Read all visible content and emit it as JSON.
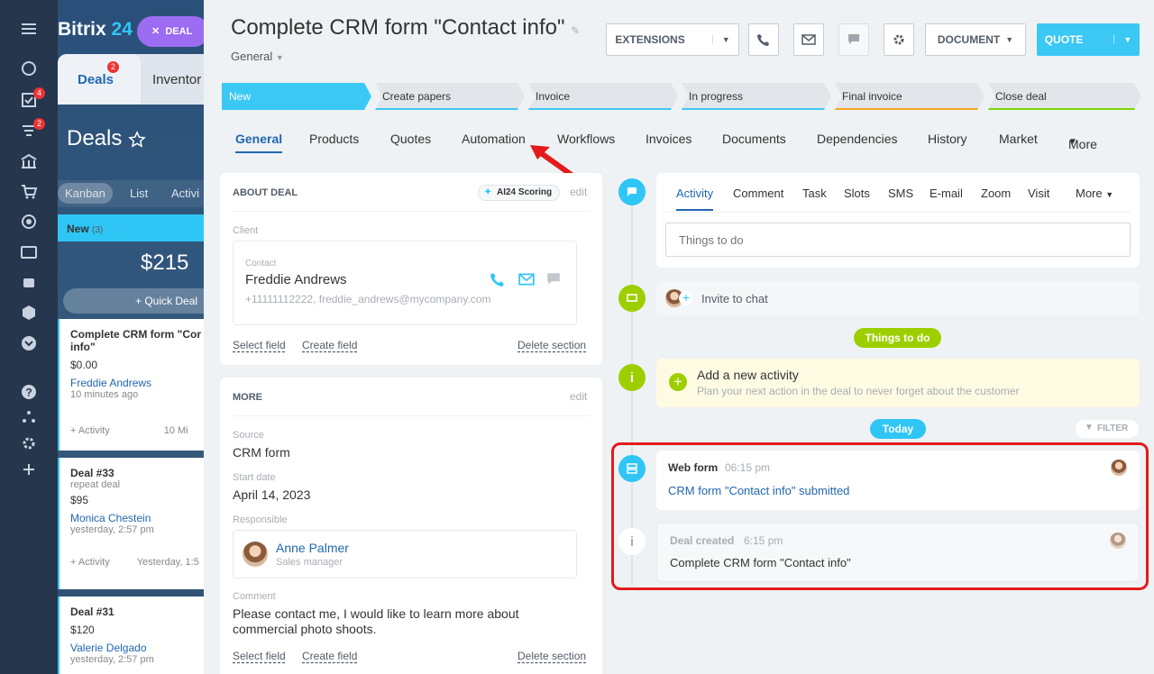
{
  "rail": {
    "badges": {
      "tasks": "4",
      "crm": "2"
    }
  },
  "bg_app": {
    "brand_name": "Bitrix",
    "brand_num": "24",
    "deal_pill": "DEAL",
    "tab_deals": "Deals",
    "tab_deals_badge": "2",
    "tab_inventory": "Inventor",
    "title": "Deals",
    "views": [
      "Kanban",
      "List",
      "Activi"
    ],
    "column": {
      "name": "New",
      "count": "(3)",
      "sum": "$215",
      "quick_deal": "Quick Deal"
    },
    "cards": [
      {
        "title": "Complete CRM form \"Cor info\"",
        "amount": "$0.00",
        "contact": "Freddie Andrews",
        "time": "10 minutes ago",
        "activity": "+ Activity",
        "right": "10 Mi"
      },
      {
        "title": "Deal #33",
        "sub": "repeat deal",
        "amount": "$95",
        "contact": "Monica Chestein",
        "time": "yesterday, 2:57 pm",
        "activity": "+ Activity",
        "right": "Yesterday, 1:5"
      },
      {
        "title": "Deal #31",
        "amount": "$120",
        "contact": "Valerie Delgado",
        "time": "yesterday, 2:57 pm"
      }
    ]
  },
  "header": {
    "title": "Complete CRM form \"Contact info\"",
    "category": "General",
    "buttons": {
      "extensions": "EXTENSIONS",
      "document": "DOCUMENT",
      "quote": "QUOTE"
    }
  },
  "stages": [
    {
      "label": "New",
      "color": "#3bc8f5"
    },
    {
      "label": "Create papers",
      "color": "#3bc8f5"
    },
    {
      "label": "Invoice",
      "color": "#3bc8f5"
    },
    {
      "label": "In progress",
      "color": "#3bc8f5"
    },
    {
      "label": "Final invoice",
      "color": "#f5a623"
    },
    {
      "label": "Close deal",
      "color": "#7bd500"
    }
  ],
  "tabs": [
    "General",
    "Products",
    "Quotes",
    "Automation",
    "Workflows",
    "Invoices",
    "Documents",
    "Dependencies",
    "History",
    "Market",
    "More"
  ],
  "about": {
    "title": "ABOUT DEAL",
    "ai_pill": "AI24 Scoring",
    "edit": "edit",
    "client_label": "Client",
    "contact_label": "Contact",
    "contact_name": "Freddie Andrews",
    "contact_info": "+11111112222, freddie_andrews@mycompany.com",
    "select_field": "Select field",
    "create_field": "Create field",
    "delete_section": "Delete section"
  },
  "more": {
    "title": "MORE",
    "edit": "edit",
    "source_label": "Source",
    "source_value": "CRM form",
    "start_label": "Start date",
    "start_value": "April 14, 2023",
    "resp_label": "Responsible",
    "resp_name": "Anne Palmer",
    "resp_role": "Sales manager",
    "comment_label": "Comment",
    "comment_value": "Please contact me, I would like to learn more about commercial photo shoots.",
    "select_field": "Select field",
    "create_field": "Create field",
    "delete_section": "Delete section"
  },
  "timeline": {
    "tabs": [
      "Activity",
      "Comment",
      "Task",
      "Slots",
      "SMS",
      "E-mail",
      "Zoom",
      "Visit",
      "More"
    ],
    "todo_placeholder": "Things to do",
    "invite": "Invite to chat",
    "things_badge": "Things to do",
    "add_title": "Add a new activity",
    "add_sub": "Plan your next action in the deal to never forget about the customer",
    "today": "Today",
    "filter": "FILTER",
    "webform_title": "Web form",
    "webform_time": "06:15 pm",
    "webform_link": "CRM form \"Contact info\" submitted",
    "created_title": "Deal created",
    "created_time": "6:15 pm",
    "created_text": "Complete CRM form \"Contact info\""
  }
}
